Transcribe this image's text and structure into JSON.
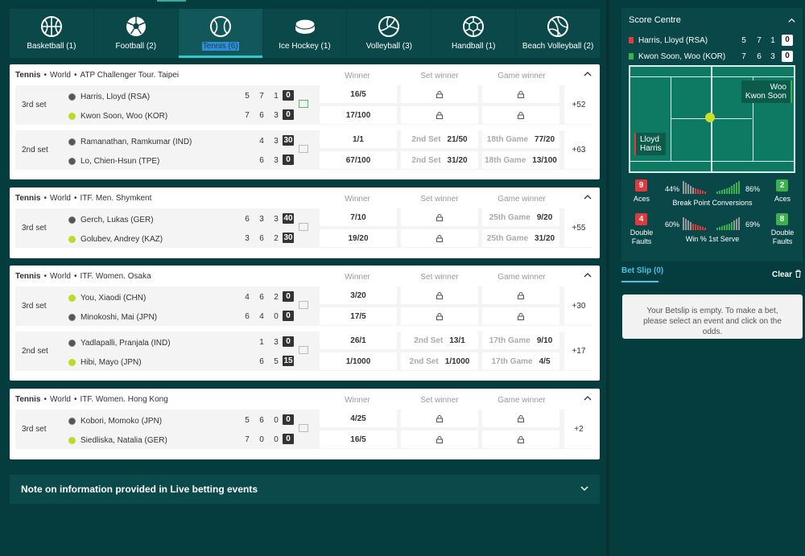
{
  "tabs": [
    {
      "label": "Basketball (1)",
      "icon": "basketball-icon"
    },
    {
      "label": "Football (2)",
      "icon": "football-icon"
    },
    {
      "label": "Tennis (6)",
      "icon": "tennis-ball-icon",
      "active": true
    },
    {
      "label": "Ice Hockey (1)",
      "icon": "hockey-puck-icon"
    },
    {
      "label": "Volleyball (3)",
      "icon": "volleyball-icon"
    },
    {
      "label": "Handball (1)",
      "icon": "handball-icon"
    },
    {
      "label": "Beach Volleyball (2)",
      "icon": "beach-volleyball-icon"
    }
  ],
  "columns": {
    "winner": "Winner",
    "set_winner": "Set winner",
    "game_winner": "Game winner"
  },
  "events": [
    {
      "sport": "Tennis",
      "region": "World",
      "tournament": "ATP Challenger Tour. Taipei",
      "matches": [
        {
          "set": "3rd set",
          "more": "+52",
          "p1": {
            "name": "Harris, Lloyd (RSA)",
            "scores": [
              "5",
              "7",
              "1"
            ],
            "points": "0",
            "ball": "grey"
          },
          "p2": {
            "name": "Kwon Soon, Woo (KOR)",
            "scores": [
              "7",
              "6",
              "3"
            ],
            "points": "0",
            "ball": "yel"
          },
          "odds": [
            {
              "winner": "16/5",
              "set": "",
              "set_lbl": "",
              "game": "",
              "game_lbl": ""
            },
            {
              "winner": "17/100",
              "set": "",
              "set_lbl": "",
              "game": "",
              "game_lbl": ""
            }
          ]
        },
        {
          "set": "2nd set",
          "more": "+63",
          "p1": {
            "name": "Ramanathan, Ramkumar (IND)",
            "scores": [
              "4",
              "3"
            ],
            "points": "30",
            "ball": "grey"
          },
          "p2": {
            "name": "Lo, Chien-Hsun (TPE)",
            "scores": [
              "6",
              "3"
            ],
            "points": "0",
            "ball": "grey"
          },
          "odds": [
            {
              "winner": "1/1",
              "set": "21/50",
              "set_lbl": "2nd Set",
              "game": "77/20",
              "game_lbl": "18th Game"
            },
            {
              "winner": "67/100",
              "set": "31/20",
              "set_lbl": "2nd Set",
              "game": "13/100",
              "game_lbl": "18th Game"
            }
          ]
        }
      ]
    },
    {
      "sport": "Tennis",
      "region": "World",
      "tournament": "ITF. Men. Shymkent",
      "matches": [
        {
          "set": "3rd set",
          "more": "+55",
          "p1": {
            "name": "Gerch, Lukas (GER)",
            "scores": [
              "6",
              "3",
              "3"
            ],
            "points": "40",
            "ball": "grey"
          },
          "p2": {
            "name": "Golubev, Andrey (KAZ)",
            "scores": [
              "3",
              "6",
              "2"
            ],
            "points": "30",
            "ball": "yel"
          },
          "odds": [
            {
              "winner": "7/10",
              "set": "",
              "set_lbl": "",
              "game": "9/20",
              "game_lbl": "25th Game"
            },
            {
              "winner": "19/20",
              "set": "",
              "set_lbl": "",
              "game": "31/20",
              "game_lbl": "25th Game"
            }
          ]
        }
      ]
    },
    {
      "sport": "Tennis",
      "region": "World",
      "tournament": "ITF. Women. Osaka",
      "matches": [
        {
          "set": "3rd set",
          "more": "+30",
          "p1": {
            "name": "You, Xiaodi (CHN)",
            "scores": [
              "4",
              "6",
              "2"
            ],
            "points": "0",
            "ball": "yel"
          },
          "p2": {
            "name": "Minokoshi, Mai (JPN)",
            "scores": [
              "6",
              "4",
              "0"
            ],
            "points": "0",
            "ball": "grey"
          },
          "odds": [
            {
              "winner": "3/20",
              "set": "",
              "set_lbl": "",
              "game": "",
              "game_lbl": ""
            },
            {
              "winner": "17/5",
              "set": "",
              "set_lbl": "",
              "game": "",
              "game_lbl": ""
            }
          ]
        },
        {
          "set": "2nd set",
          "more": "+17",
          "p1": {
            "name": "Yadlapalli, Pranjala (IND)",
            "scores": [
              "1",
              "3"
            ],
            "points": "0",
            "ball": "grey"
          },
          "p2": {
            "name": "Hibi, Mayo (JPN)",
            "scores": [
              "6",
              "5"
            ],
            "points": "15",
            "ball": "yel"
          },
          "odds": [
            {
              "winner": "26/1",
              "set": "13/1",
              "set_lbl": "2nd Set",
              "game": "9/10",
              "game_lbl": "17th Game"
            },
            {
              "winner": "1/1000",
              "set": "1/1000",
              "set_lbl": "2nd Set",
              "game": "4/5",
              "game_lbl": "17th Game"
            }
          ]
        }
      ]
    },
    {
      "sport": "Tennis",
      "region": "World",
      "tournament": "ITF. Women. Hong Kong",
      "matches": [
        {
          "set": "3rd set",
          "more": "+2",
          "p1": {
            "name": "Kobori, Momoko (JPN)",
            "scores": [
              "5",
              "6",
              "0"
            ],
            "points": "0",
            "ball": "grey"
          },
          "p2": {
            "name": "Siedliska, Natalia (GER)",
            "scores": [
              "7",
              "0",
              "0"
            ],
            "points": "0",
            "ball": "yel"
          },
          "odds": [
            {
              "winner": "4/25",
              "set": "",
              "set_lbl": "",
              "game": "",
              "game_lbl": ""
            },
            {
              "winner": "16/5",
              "set": "",
              "set_lbl": "",
              "game": "",
              "game_lbl": ""
            }
          ]
        }
      ]
    }
  ],
  "note": "Note on information provided in Live betting events",
  "score_centre": {
    "title": "Score Centre",
    "p1": {
      "name": "Harris, Lloyd (RSA)",
      "scores": [
        "5",
        "7",
        "1"
      ],
      "points": "0",
      "color": "#e0393e"
    },
    "p2": {
      "name": "Kwon Soon, Woo (KOR)",
      "scores": [
        "7",
        "6",
        "3"
      ],
      "points": "0",
      "color": "#3cb04a"
    },
    "court_left": "Lloyd\nHarris",
    "court_right": "Woo\nKwon Soon",
    "left_l1": "Lloyd",
    "left_l2": "Harris",
    "right_l1": "Woo",
    "right_l2": "Kwon Soon",
    "aces_label": "Aces",
    "aces_p1": "9",
    "aces_p2": "2",
    "bp_label": "Break Point Conversions",
    "bp_p1": "44%",
    "bp_p2": "86%",
    "df_label1": "Double",
    "df_label2": "Faults",
    "df_p1": "4",
    "df_p2": "8",
    "ws_label": "Win % 1st Serve",
    "ws_p1": "60%",
    "ws_p2": "69%"
  },
  "betslip": {
    "tab": "Bet Slip (0)",
    "clear": "Clear",
    "empty_text": "Your Betslip is empty. To make a bet, please select an event and click on the odds."
  }
}
